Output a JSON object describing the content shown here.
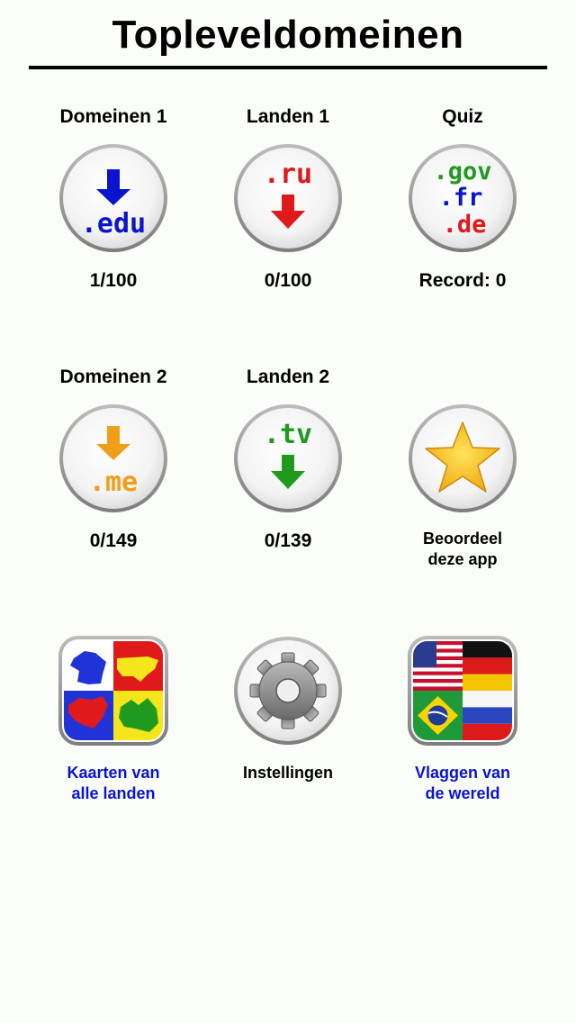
{
  "header": {
    "title": "Topleveldomeinen"
  },
  "colors": {
    "background": "#fafdf8",
    "blue": "#0a14d0",
    "red": "#e0191a",
    "green": "#1f9a1f",
    "orange": "#f0a018",
    "star": "#f6c21a"
  },
  "grid": {
    "row1": [
      {
        "title": "Domeinen 1",
        "progress": "1/100",
        "glyph_top": "",
        "glyph_bottom": ".edu",
        "icon": "arrow-down-icon"
      },
      {
        "title": "Landen 1",
        "progress": "0/100",
        "glyph_top": ".ru",
        "glyph_bottom": "",
        "icon": "arrow-down-icon"
      },
      {
        "title": "Quiz",
        "progress": "Record: 0",
        "lines": [
          ".gov",
          ".fr",
          ".de"
        ]
      }
    ],
    "row2": [
      {
        "title": "Domeinen 2",
        "progress": "0/149",
        "glyph_bottom": ".me",
        "icon": "arrow-down-icon"
      },
      {
        "title": "Landen 2",
        "progress": "0/139",
        "glyph_top": ".tv",
        "icon": "arrow-down-icon"
      },
      {
        "caption_line1": "Beoordeel",
        "caption_line2": "deze app",
        "icon": "star-icon"
      }
    ],
    "row3": [
      {
        "caption_line1": "Kaarten van",
        "caption_line2": "alle landen",
        "icon": "world-maps-icon"
      },
      {
        "caption_line1": "Instellingen",
        "icon": "gear-icon"
      },
      {
        "caption_line1": "Vlaggen van",
        "caption_line2": "de wereld",
        "icon": "world-flags-icon"
      }
    ]
  }
}
